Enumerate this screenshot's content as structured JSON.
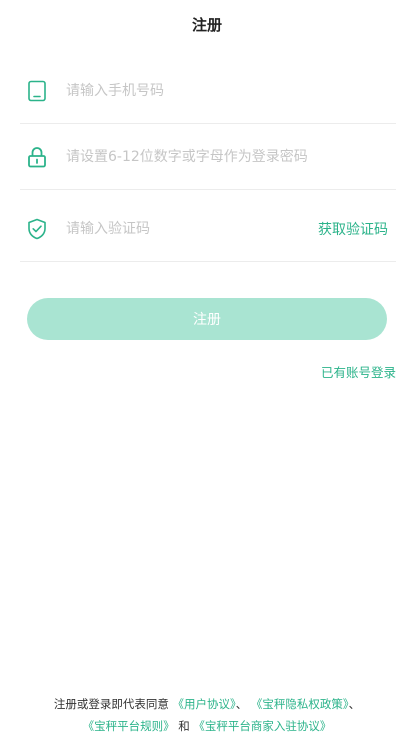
{
  "header": {
    "title": "注册"
  },
  "form": {
    "phone": {
      "icon": "phone-icon",
      "placeholder": "请输入手机号码",
      "value": ""
    },
    "password": {
      "icon": "lock-icon",
      "placeholder": "请设置6-12位数字或字母作为登录密码",
      "value": ""
    },
    "code": {
      "icon": "shield-check-icon",
      "placeholder": "请输入验证码",
      "value": "",
      "get_code_label": "获取验证码"
    }
  },
  "register_button": {
    "label": "注册"
  },
  "login_link": {
    "label": "已有账号登录"
  },
  "agreement": {
    "prefix": "注册或登录即代表同意",
    "link1": "《用户协议》",
    "sep1": "、",
    "link2": "《宝秤隐私权政策》",
    "sep2": "、",
    "link3": "《宝秤平台规则》",
    "and": "和",
    "link4": "《宝秤平台商家入驻协议》"
  },
  "colors": {
    "accent": "#2bb38a",
    "button_bg": "#a9e4d2",
    "placeholder": "#c6c6c6",
    "divider": "#ececec",
    "text": "#333333"
  }
}
